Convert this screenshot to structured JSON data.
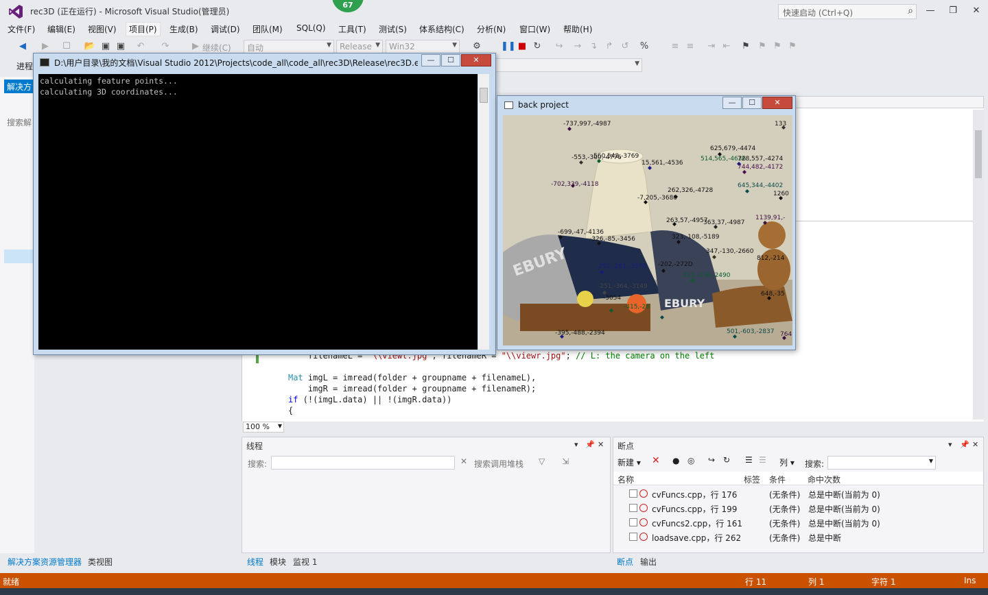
{
  "titlebar": {
    "title": "rec3D (正在运行) - Microsoft Visual Studio(管理员)",
    "badge": "67",
    "quick_launch": "快速启动 (Ctrl+Q)"
  },
  "menu": [
    "文件(F)",
    "编辑(E)",
    "视图(V)",
    "项目(P)",
    "生成(B)",
    "调试(D)",
    "团队(M)",
    "SQL(Q)",
    "工具(T)",
    "测试(S)",
    "体系结构(C)",
    "分析(N)",
    "窗口(W)",
    "帮助(H)"
  ],
  "toolbar": {
    "continue": "继续(C)",
    "auto": "自动",
    "config": "Release",
    "platform": "Win32",
    "process_label": "进程"
  },
  "solution": {
    "tab": "解决方",
    "search": "搜索解"
  },
  "console": {
    "title": "D:\\用户目录\\我的文档\\Visual Studio 2012\\Projects\\code_all\\code_all\\rec3D\\Release\\rec3D.e...",
    "output": "calculating feature points...\ncalculating 3D coordinates..."
  },
  "backproject": {
    "title": "back project",
    "labels": [
      {
        "t": "-737,997,-4987",
        "c": "#3a1040"
      },
      {
        "t": "133",
        "c": "#111"
      },
      {
        "t": "-553,-300,-4776",
        "c": "#222"
      },
      {
        "t": "560,542,-3769",
        "c": "#222"
      },
      {
        "t": "625,679,-4474",
        "c": "#111"
      },
      {
        "t": "514,565,-4636",
        "c": "#0b5a30"
      },
      {
        "t": "728,557,-4274",
        "c": "#111"
      },
      {
        "t": "15,561,-4536",
        "c": "#111"
      },
      {
        "t": "744,482,-4172",
        "c": "#4a0a50"
      },
      {
        "t": "-702,339,-4118",
        "c": "#3a1040"
      },
      {
        "t": "645,344,-4402",
        "c": "#0a4a4a"
      },
      {
        "t": "262,326,-4728",
        "c": "#111"
      },
      {
        "t": "1260",
        "c": "#111"
      },
      {
        "t": "-7,205,-3680",
        "c": "#111"
      },
      {
        "t": "263,57,-4957",
        "c": "#111"
      },
      {
        "t": "363,37,-4987",
        "c": "#222"
      },
      {
        "t": "1139,91,-",
        "c": "#3a1040"
      },
      {
        "t": "-699,-47,-4136",
        "c": "#111"
      },
      {
        "t": "-326,-85,-3456",
        "c": "#111"
      },
      {
        "t": "323,-108,-5189",
        "c": "#111"
      },
      {
        "t": "347,-130,-2660",
        "c": "#332"
      },
      {
        "t": "-202,-272D",
        "c": "#111"
      },
      {
        "t": "-252,-261,-3370",
        "c": "#1a1a80"
      },
      {
        "t": "215,-236,-2490",
        "c": "#0b5a30"
      },
      {
        "t": "812,-214",
        "c": "#222"
      },
      {
        "t": "-251,-364,-3149",
        "c": "#444"
      },
      {
        "t": "648,-35",
        "c": "#111"
      },
      {
        "t": "-3054",
        "c": "#333"
      },
      {
        "t": "-415,-26",
        "c": "#0b5a30"
      },
      {
        "t": "-395,-488,-2394",
        "c": "#111"
      },
      {
        "t": "501,-603,-2837",
        "c": "#0a4a4a"
      },
      {
        "t": "764",
        "c": "#3a1040"
      }
    ]
  },
  "editor": {
    "zoom": "100 %"
  },
  "threads": {
    "title": "线程",
    "search_label": "搜索:",
    "search_call_stack": "搜索调用堆栈"
  },
  "breakpoints": {
    "title": "断点",
    "new": "新建",
    "columns_btn": "列",
    "search_label": "搜索:",
    "headers": [
      "名称",
      "标签",
      "条件",
      "命中次数"
    ],
    "rows": [
      {
        "name": "cvFuncs.cpp，行 176",
        "cond": "(无条件)",
        "hit": "总是中断(当前为 0)"
      },
      {
        "name": "cvFuncs.cpp，行 199",
        "cond": "(无条件)",
        "hit": "总是中断(当前为 0)"
      },
      {
        "name": "cvFuncs2.cpp，行 161",
        "cond": "(无条件)",
        "hit": "总是中断(当前为 0)"
      },
      {
        "name": "loadsave.cpp，行 262",
        "cond": "(无条件)",
        "hit": "总是中断"
      }
    ]
  },
  "bottom_tabs": {
    "left": [
      "解决方案资源管理器",
      "类视图"
    ],
    "middle": [
      "线程",
      "模块",
      "监视 1"
    ],
    "right": [
      "断点",
      "输出"
    ]
  },
  "status": {
    "ready": "就绪",
    "line": "行 11",
    "col": "列 1",
    "ch": "字符 1",
    "ins": "Ins"
  },
  "colors": {
    "accent": "#007acc",
    "status_debug": "#ca5100",
    "badge_green": "#2ea04f",
    "breakpoint_red": "#d02020"
  }
}
